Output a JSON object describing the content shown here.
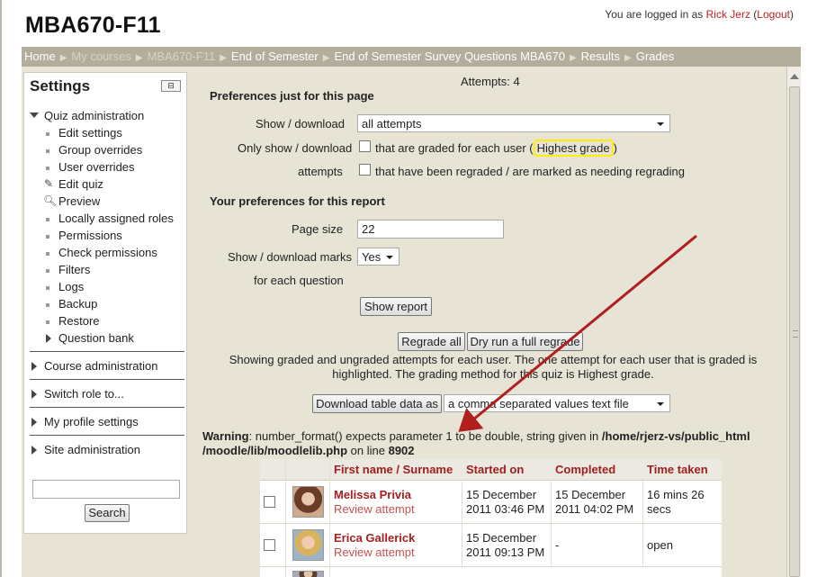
{
  "site": {
    "title": "MBA670-F11"
  },
  "login": {
    "prefix": "You are logged in as ",
    "user": "Rick Jerz",
    "logout": "Logout"
  },
  "breadcrumb": [
    "Home",
    "My courses",
    "MBA670-F11",
    "End of Semester",
    "End of Semester Survey Questions MBA670",
    "Results",
    "Grades"
  ],
  "settings": {
    "title": "Settings",
    "quiz_admin": "Quiz administration",
    "quiz_items": [
      "Edit settings",
      "Group overrides",
      "User overrides",
      "Edit quiz",
      "Preview",
      "Locally assigned roles",
      "Permissions",
      "Check permissions",
      "Filters",
      "Logs",
      "Backup",
      "Restore",
      "Question bank"
    ],
    "sections": [
      "Course administration",
      "Switch role to...",
      "My profile settings",
      "Site administration"
    ],
    "search_button": "Search"
  },
  "main": {
    "attempts": "Attempts: 4",
    "prefs_page_heading": "Preferences just for this page",
    "show_download_label": "Show / download",
    "show_download_value": "all attempts",
    "only_show_label": "Only show / download",
    "attempts_label": "attempts",
    "graded_text_before": "that are graded for each user (",
    "graded_highlight": "Highest grade",
    "graded_text_after": ")",
    "regraded_text": "that have been regraded / are marked as needing regrading",
    "prefs_report_heading": "Your preferences for this report",
    "page_size_label": "Page size",
    "page_size_value": "22",
    "marks_label": "Show / download marks",
    "marks_value": "Yes",
    "for_each_question": "for each question",
    "show_report_button": "Show report",
    "regrade_all_button": "Regrade all",
    "dry_run_button": "Dry run a full regrade",
    "info_line1": "Showing graded and ungraded attempts for each user. The one attempt for each user that is graded is",
    "info_line2": "highlighted. The grading method for this quiz is Highest grade.",
    "download_button": "Download table data as",
    "download_format": "a comma separated values text file",
    "warning_label": "Warning",
    "warning_text": ": number_format() expects parameter 1 to be double, string given in ",
    "warning_path": "/home/rjerz-vs/public_html /moodle/lib/moodlelib.php",
    "warning_online": " on line ",
    "warning_line": "8902"
  },
  "table": {
    "headers": {
      "first_name": "First name",
      "slash": " / ",
      "surname": "Surname",
      "started": "Started on",
      "completed": "Completed",
      "time_taken": "Time taken"
    },
    "rows": [
      {
        "name": "Melissa Privia",
        "review": "Review attempt",
        "started_1": "15 December",
        "started_2": "2011 03:46 PM",
        "completed_1": "15 December",
        "completed_2": "2011 04:02 PM",
        "time_1": "16 mins 26",
        "time_2": "secs"
      },
      {
        "name": "Erica Gallerick",
        "review": "Review attempt",
        "started_1": "15 December",
        "started_2": "2011 09:13 PM",
        "completed_1": "-",
        "completed_2": "",
        "time_1": "open",
        "time_2": ""
      }
    ]
  },
  "colors": {
    "accent_link": "#a52020",
    "navbar": "#b3ad9c",
    "page_bg": "#e7e4d6",
    "highlight": "#ffee00",
    "arrow": "#b01e1e"
  }
}
